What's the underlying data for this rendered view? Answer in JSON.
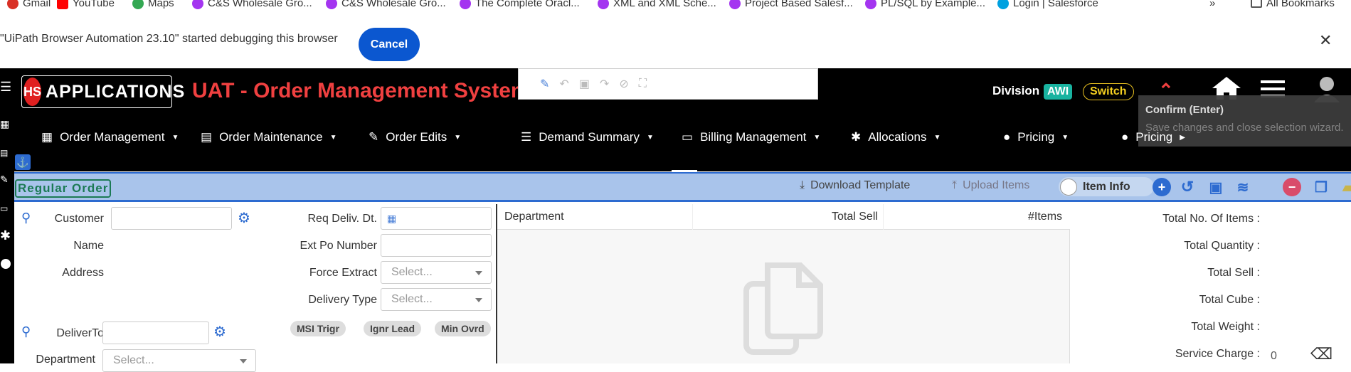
{
  "bookmarks": {
    "items": [
      {
        "label": "Gmail",
        "icon": "gmail-icon",
        "color": "#d93025"
      },
      {
        "label": "YouTube",
        "icon": "youtube-icon",
        "color": "#ff0000"
      },
      {
        "label": "Maps",
        "icon": "maps-icon",
        "color": "#34a853"
      },
      {
        "label": "C&S Wholesale Gro...",
        "icon": "udemy-icon",
        "color": "#a435f0"
      },
      {
        "label": "C&S Wholesale Gro...",
        "icon": "udemy-icon",
        "color": "#a435f0"
      },
      {
        "label": "The Complete Oracl...",
        "icon": "udemy-icon",
        "color": "#a435f0"
      },
      {
        "label": "XML and XML Sche...",
        "icon": "udemy-icon",
        "color": "#a435f0"
      },
      {
        "label": "Project Based Salesf...",
        "icon": "udemy-icon",
        "color": "#a435f0"
      },
      {
        "label": "PL/SQL by Example...",
        "icon": "udemy-icon",
        "color": "#a435f0"
      },
      {
        "label": "Login | Salesforce",
        "icon": "salesforce-icon",
        "color": "#00a1e0"
      }
    ],
    "more": "»",
    "all_bookmarks": "All Bookmarks"
  },
  "debug_banner": {
    "message": "\"UiPath Browser Automation 23.10\" started debugging this browser",
    "cancel_label": "Cancel",
    "close": "✕"
  },
  "header": {
    "logo_mark": "HS",
    "logo_text": "APPLICATIONS",
    "title": "UAT - Order Management System",
    "division_label": "Division",
    "division_value": "AWI",
    "switch_label": "Switch",
    "tooltip_title": "Confirm (Enter)",
    "tooltip_desc": "Save changes and close selection wizard."
  },
  "nav": {
    "items": [
      {
        "label": "Order Management"
      },
      {
        "label": "Order Maintenance"
      },
      {
        "label": "Order Edits"
      },
      {
        "label": "Demand Summary"
      },
      {
        "label": "Billing Management"
      },
      {
        "label": "Allocations"
      },
      {
        "label": "Pricing"
      },
      {
        "label": "Pricing"
      }
    ]
  },
  "ribbon": {
    "order_type": "Regular Order",
    "download_template": "Download Template",
    "upload_items": "Upload Items",
    "item_info": "Item Info"
  },
  "form": {
    "customer_label": "Customer",
    "name_label": "Name",
    "address_label": "Address",
    "deliver_to_label": "DeliverTo",
    "department_label": "Department",
    "department_placeholder": "Select...",
    "req_deliv_label": "Req Deliv. Dt.",
    "ext_po_label": "Ext Po Number",
    "force_extract_label": "Force Extract",
    "force_extract_placeholder": "Select...",
    "delivery_type_label": "Delivery Type",
    "delivery_type_placeholder": "Select...",
    "chips": [
      "MSI Trigr",
      "Ignr Lead",
      "Min Ovrd"
    ]
  },
  "grid": {
    "columns": [
      "Department",
      "Total Sell",
      "#Items"
    ]
  },
  "summary": {
    "labels": [
      "Total No. Of Items :",
      "Total Quantity :",
      "Total Sell :",
      "Total Cube :",
      "Total Weight :",
      "Service Charge :"
    ],
    "service_charge_value": "0"
  },
  "colors": {
    "header_bg": "#000000",
    "title_red": "#f04040",
    "ribbon_bg": "#a9c4eb",
    "accent_blue": "#2d6bd0",
    "awi_green": "#19b3a0",
    "switch_yellow": "#f5d020"
  }
}
